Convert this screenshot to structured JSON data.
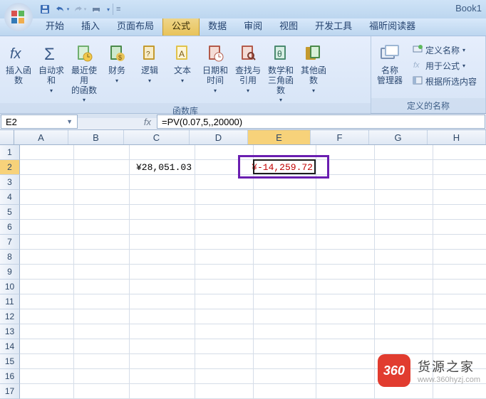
{
  "title": "Book1",
  "qat_icons": [
    "save-icon",
    "undo-icon",
    "redo-icon",
    "quickprint-icon"
  ],
  "tabs": [
    {
      "label": "开始"
    },
    {
      "label": "插入"
    },
    {
      "label": "页面布局"
    },
    {
      "label": "公式",
      "active": true
    },
    {
      "label": "数据"
    },
    {
      "label": "审阅"
    },
    {
      "label": "视图"
    },
    {
      "label": "开发工具"
    },
    {
      "label": "福昕阅读器"
    }
  ],
  "ribbon": {
    "library": {
      "label": "函数库",
      "buttons": [
        {
          "key": "insert-fn",
          "label": "插入函数",
          "dd": false
        },
        {
          "key": "autosum",
          "label": "自动求和",
          "dd": true
        },
        {
          "key": "recent",
          "label": "最近使用\n的函数",
          "dd": true
        },
        {
          "key": "financial",
          "label": "财务",
          "dd": true
        },
        {
          "key": "logical",
          "label": "逻辑",
          "dd": true
        },
        {
          "key": "text",
          "label": "文本",
          "dd": true
        },
        {
          "key": "datetime",
          "label": "日期和\n时间",
          "dd": true
        },
        {
          "key": "lookup",
          "label": "查找与\n引用",
          "dd": true
        },
        {
          "key": "math",
          "label": "数学和\n三角函数",
          "dd": true
        },
        {
          "key": "more",
          "label": "其他函数",
          "dd": true
        }
      ]
    },
    "names": {
      "label": "定义的名称",
      "manager": "名称\n管理器",
      "items": [
        {
          "key": "define",
          "label": "定义名称"
        },
        {
          "key": "use",
          "label": "用于公式"
        },
        {
          "key": "create",
          "label": "根据所选内容"
        }
      ]
    }
  },
  "namebox": "E2",
  "formula": "=PV(0.07,5,,20000)",
  "columns": [
    "A",
    "B",
    "C",
    "D",
    "E",
    "F",
    "G",
    "H"
  ],
  "colClasses": [
    "cA",
    "cB",
    "cC",
    "cD",
    "cE",
    "cF",
    "cG",
    "cH"
  ],
  "rows": 17,
  "selected": {
    "col": "E",
    "row": 2,
    "colIdx": 4
  },
  "cellsData": {
    "C2": {
      "text": "¥28,051.03",
      "neg": false
    },
    "E2": {
      "text": "¥-14,259.72",
      "neg": true
    }
  },
  "watermark": {
    "badge": "360",
    "title": "货源之家",
    "url": "www.360hyzj.com"
  }
}
